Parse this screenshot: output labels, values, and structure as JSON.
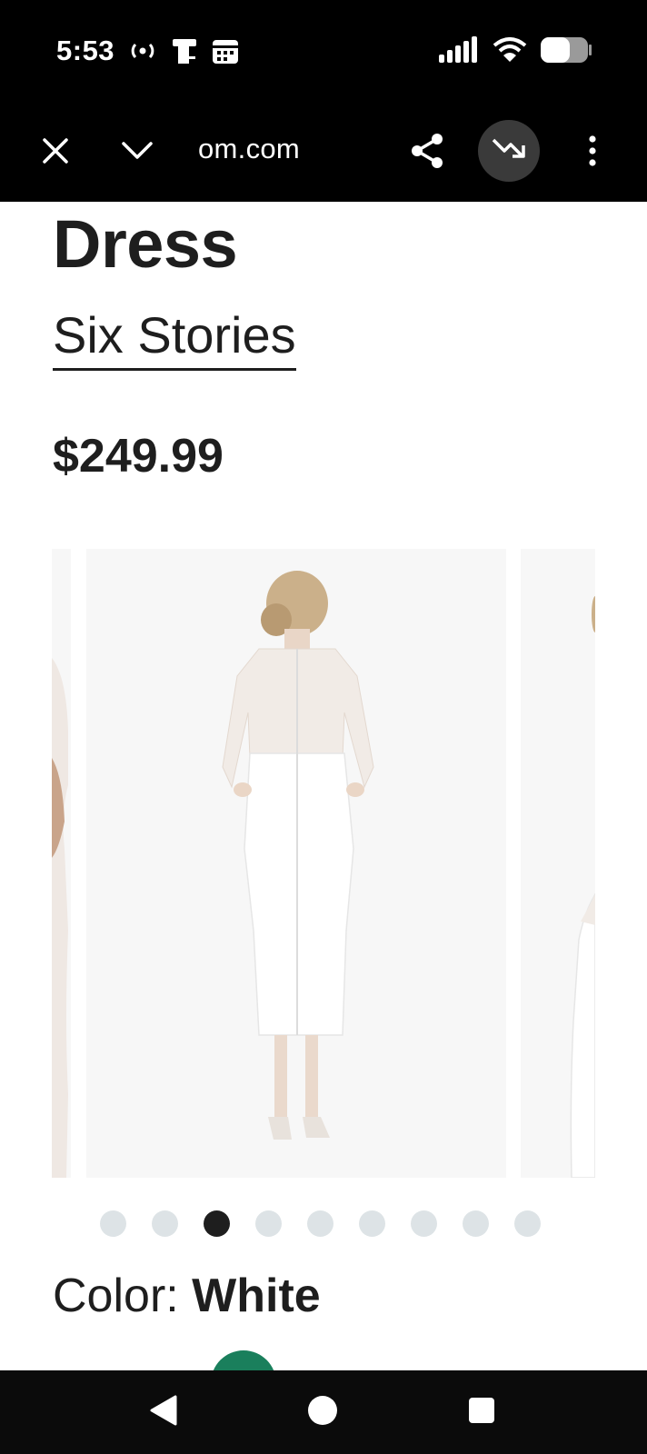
{
  "status_bar": {
    "time": "5:53",
    "left_icons": [
      "broadcast-icon",
      "device-icon",
      "calendar-icon"
    ],
    "right_icons": [
      "signal-icon",
      "wifi-icon",
      "battery-icon"
    ]
  },
  "browser": {
    "url": "om.com",
    "buttons": [
      "close-icon",
      "chevron-down-icon",
      "share-icon",
      "trending-down-icon",
      "more-vert-icon"
    ]
  },
  "product": {
    "title": "Dress",
    "brand": "Six Stories",
    "price": "$249.99",
    "gallery": {
      "total_images": 9,
      "active_index": 2
    },
    "color_label": "Color:",
    "color_value": "White"
  },
  "colors": {
    "bars": "#000000",
    "text": "#1e1e1e",
    "dot_inactive": "#dde3e6",
    "swatch": "#1a7f5c"
  },
  "nav_bar": {
    "buttons": [
      "back-icon",
      "home-icon",
      "recents-icon"
    ]
  }
}
